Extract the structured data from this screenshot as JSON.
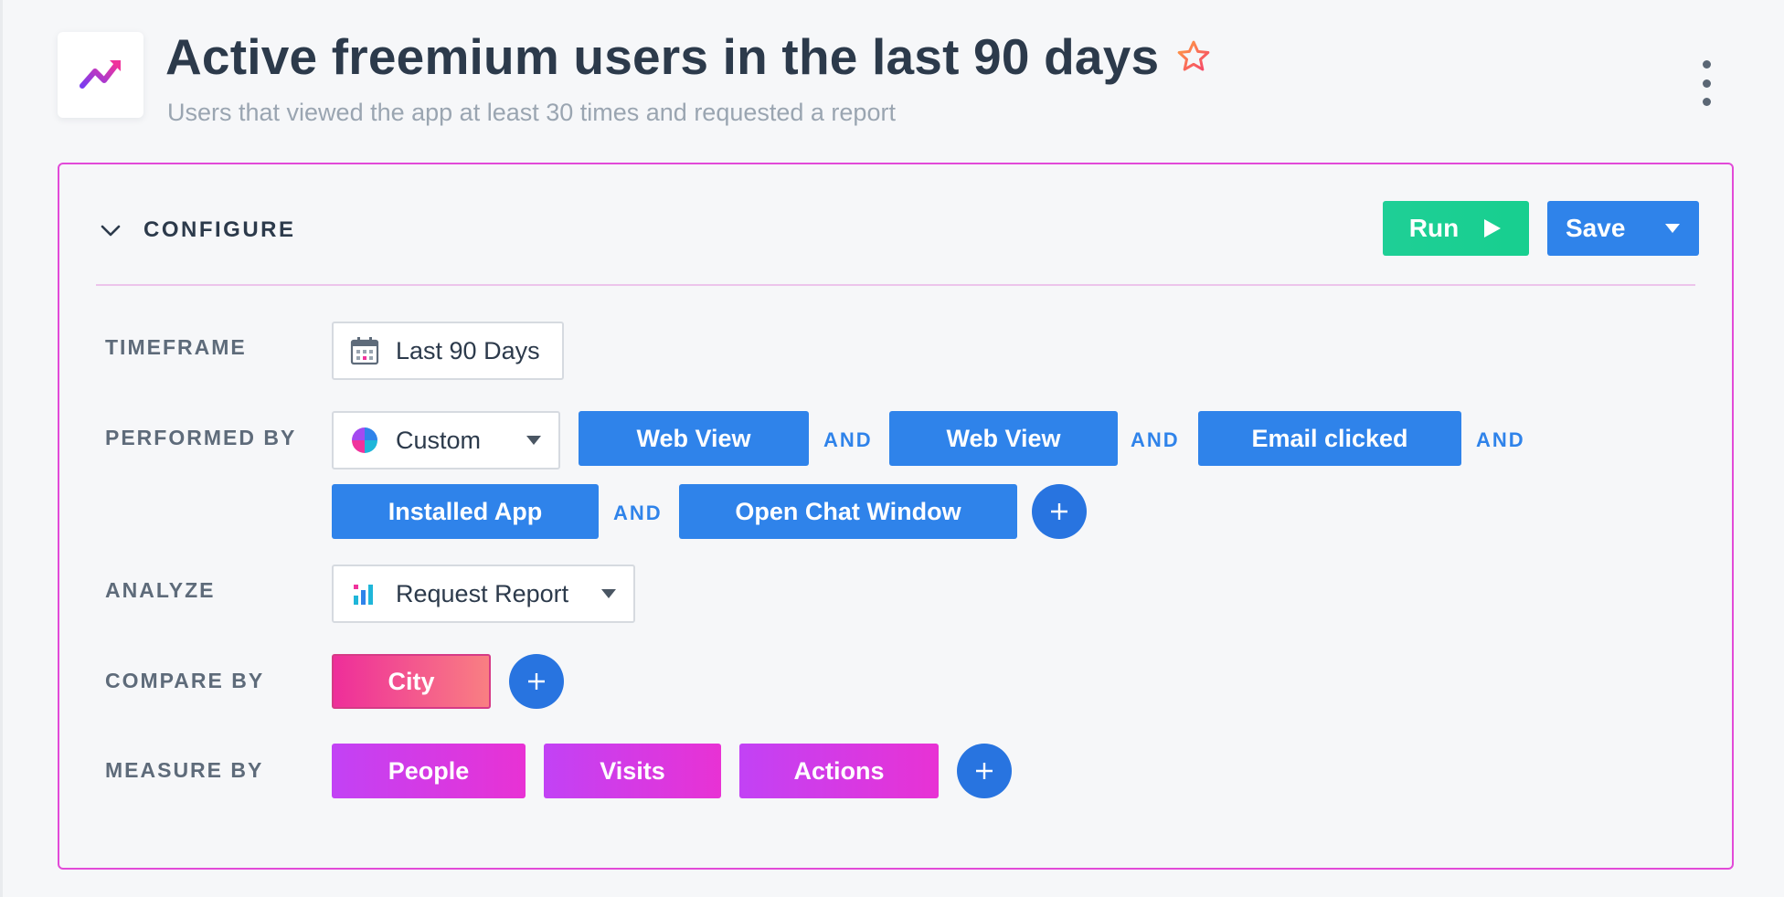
{
  "header": {
    "title": "Active freemium users in the last 90 days",
    "subtitle": "Users that viewed the app at least 30 times and requested a report",
    "icons": {
      "logo": "trend-line-icon",
      "favorite": "star-outline-icon",
      "menu": "more-vertical-icon"
    }
  },
  "configure": {
    "label": "CONFIGURE",
    "run_label": "Run",
    "save_label": "Save"
  },
  "rows": {
    "timeframe": {
      "label": "TIMEFRAME",
      "value": "Last 90 Days"
    },
    "performed_by": {
      "label": "PERFORMED BY",
      "selector": "Custom",
      "connector": "AND",
      "events": [
        "Web View",
        "Web View",
        "Email clicked",
        "Installed App",
        "Open Chat Window"
      ]
    },
    "analyze": {
      "label": "ANALYZE",
      "value": "Request Report"
    },
    "compare_by": {
      "label": "COMPARE BY",
      "items": [
        "City"
      ]
    },
    "measure_by": {
      "label": "MEASURE BY",
      "items": [
        "People",
        "Visits",
        "Actions"
      ]
    }
  },
  "colors": {
    "accent_blue": "#2f83ea",
    "run_green": "#1fcf96",
    "panel_border": "#e24ad8",
    "compare_pink": "#ee2e9a",
    "measure_purple": "#c242f5"
  }
}
